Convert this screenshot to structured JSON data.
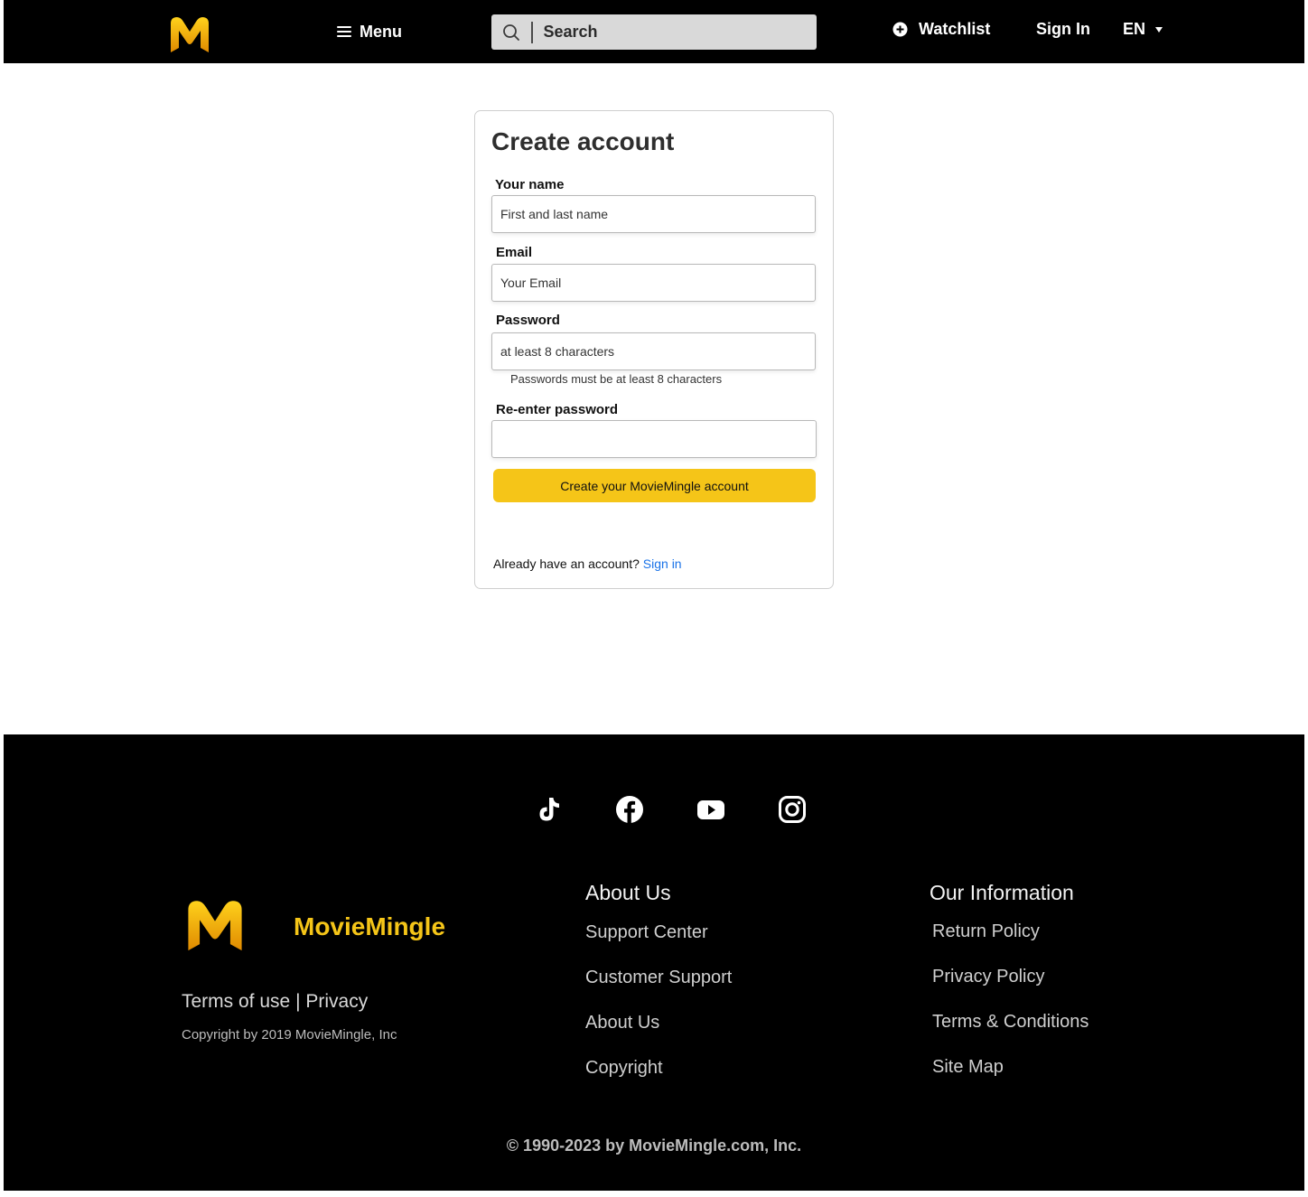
{
  "header": {
    "menu_label": "Menu",
    "search_placeholder": "Search",
    "watchlist_label": "Watchlist",
    "signin_label": "Sign In",
    "language": "EN"
  },
  "form": {
    "title": "Create account",
    "name_label": "Your name",
    "name_placeholder": "First and last name",
    "email_label": "Email",
    "email_placeholder": "Your Email",
    "password_label": "Password",
    "password_placeholder": "at least 8 characters",
    "password_hint": "Passwords must be at least 8 characters",
    "reenter_label": "Re-enter password",
    "submit_label": "Create your MovieMingle account",
    "already_text": "Already have an account?",
    "signin_link": "Sign in"
  },
  "footer": {
    "social_icons": [
      "tiktok-icon",
      "facebook-icon",
      "youtube-icon",
      "instagram-icon"
    ],
    "brand_name": "MovieMingle",
    "terms_link": "Terms of use",
    "separator": "|",
    "privacy_link": "Privacy",
    "copyright_small": "Copyright by 2019 MovieMingle, Inc",
    "about_title": "About Us",
    "about_links": [
      "Support Center",
      "Customer Support",
      "About Us",
      "Copyright"
    ],
    "info_title": "Our Information",
    "info_links": [
      "Return Policy",
      "Privacy Policy",
      "Terms & Conditions",
      "Site Map"
    ],
    "copyright_big": "© 1990-2023 by MovieMingle.com, Inc."
  },
  "colors": {
    "brand_yellow": "#f5c518",
    "header_bg": "#000000",
    "link_blue": "#1a73e8"
  }
}
